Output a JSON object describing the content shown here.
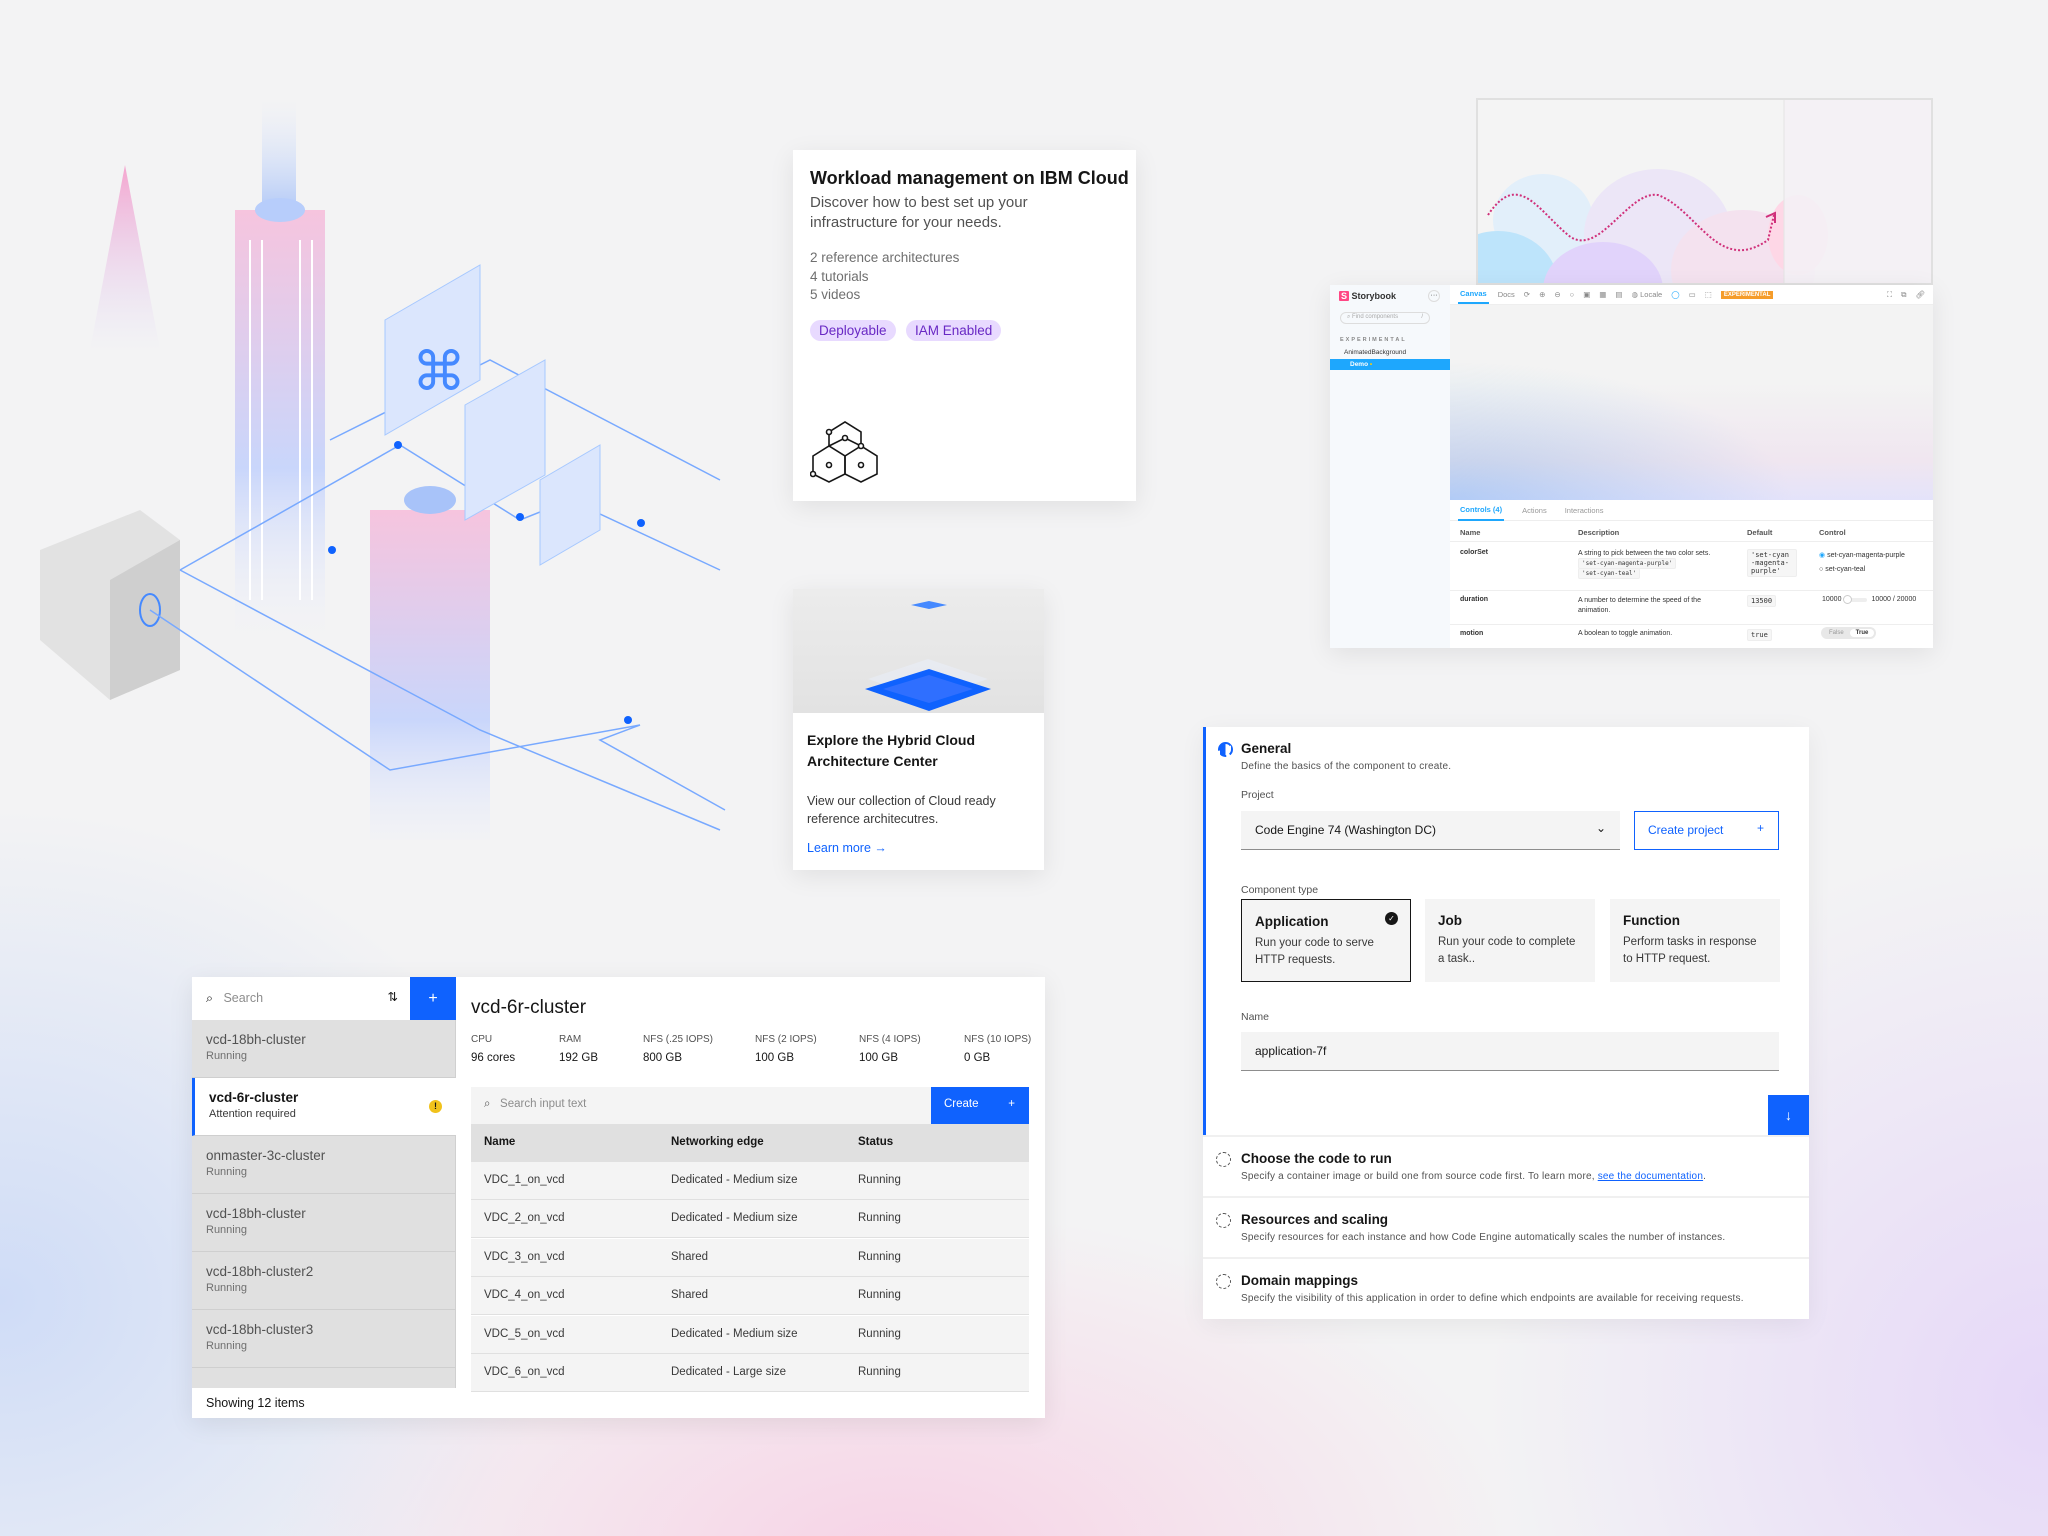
{
  "colors": {
    "accent": "#0f62fe",
    "tag_bg": "#e8daff",
    "tag_text": "#6929c4",
    "storybook_pink": "#ff4785",
    "experimental": "#f59c2a",
    "warning": "#f1c21b"
  },
  "workload_card": {
    "title": "Workload management on IBM Cloud",
    "description": "Discover how to best set up your infrastructure for your needs.",
    "meta": [
      "2 reference architectures",
      "4 tutorials",
      "5 videos"
    ],
    "tags": [
      "Deployable",
      "IAM Enabled"
    ],
    "icon": "hexagon-network-icon"
  },
  "hybrid_card": {
    "title": "Explore the Hybrid Cloud Architecture Center",
    "description": "View our collection of Cloud ready reference architecutres.",
    "link": "Learn more"
  },
  "storybook": {
    "brand": "Storybook",
    "search_placeholder": "Find components",
    "search_shortcut": "/",
    "group": "EXPERIMENTAL",
    "component": "AnimatedBackground",
    "story": "Demo",
    "toolbar": {
      "tabs": [
        "Canvas",
        "Docs"
      ],
      "locale": "Locale",
      "badge": "EXPERIMENTAL"
    },
    "addon_tabs": [
      "Controls (4)",
      "Actions",
      "Interactions"
    ],
    "columns": [
      "Name",
      "Description",
      "Default",
      "Control"
    ],
    "rows": [
      {
        "name": "colorSet",
        "description": "A string to pick between the two color sets.",
        "codes": [
          "'set-cyan-magenta-purple'",
          "'set-cyan-teal'"
        ],
        "default": "'set-cyan-magenta-purple'",
        "options": [
          "set-cyan-magenta-purple",
          "set-cyan-teal"
        ],
        "selected": 0
      },
      {
        "name": "duration",
        "description": "A number to determine the speed of the animation.",
        "default": "13500",
        "min": "10000",
        "range": "10000 / 20000",
        "value": 10000
      },
      {
        "name": "motion",
        "description": "A boolean to toggle animation.",
        "default": "true",
        "toggle": [
          "False",
          "True"
        ],
        "selected": "True"
      }
    ]
  },
  "form": {
    "general": {
      "title": "General",
      "description": "Define the basics of the component to create.",
      "status": "in-progress"
    },
    "project_label": "Project",
    "project_value": "Code Engine 74 (Washington DC)",
    "create_project": "Create project",
    "component_type_label": "Component type",
    "types": [
      {
        "title": "Application",
        "description": "Run your code to serve HTTP requests.",
        "selected": true
      },
      {
        "title": "Job",
        "description": "Run your code to complete a task..",
        "selected": false
      },
      {
        "title": "Function",
        "description": "Perform tasks in response to HTTP request.",
        "selected": false
      }
    ],
    "name_label": "Name",
    "name_value": "application-7f",
    "sections": [
      {
        "title": "Choose the code to run",
        "description": "Specify a container image or build one from source code first. To learn more, ",
        "link": "see the documentation",
        "suffix": "."
      },
      {
        "title": "Resources and scaling",
        "description": "Specify resources for each instance and how Code Engine automatically scales the number of instances."
      },
      {
        "title": "Domain mappings",
        "description": "Specify the visibility of this application in order to define which endpoints are available for receiving requests."
      }
    ]
  },
  "clusters": {
    "search_placeholder": "Search",
    "footer": "Showing 12 items",
    "items": [
      {
        "name": "vcd-18bh-cluster",
        "status": "Running"
      },
      {
        "name": "vcd-6r-cluster",
        "status": "Attention required",
        "selected": true
      },
      {
        "name": "onmaster-3c-cluster",
        "status": "Running"
      },
      {
        "name": "vcd-18bh-cluster",
        "status": "Running"
      },
      {
        "name": "vcd-18bh-cluster2",
        "status": "Running"
      },
      {
        "name": "vcd-18bh-cluster3",
        "status": "Running"
      }
    ],
    "detail": {
      "title": "vcd-6r-cluster",
      "stats": [
        {
          "label": "CPU",
          "value": "96 cores"
        },
        {
          "label": "RAM",
          "value": "192 GB"
        },
        {
          "label": "NFS (.25 IOPS)",
          "value": "800 GB"
        },
        {
          "label": "NFS (2 IOPS)",
          "value": "100 GB"
        },
        {
          "label": "NFS (4 IOPS)",
          "value": "100 GB"
        },
        {
          "label": "NFS (10 IOPS)",
          "value": "0 GB"
        }
      ],
      "search_placeholder": "Search input text",
      "create": "Create",
      "columns": [
        "Name",
        "Networking edge",
        "Status"
      ],
      "rows": [
        [
          "VDC_1_on_vcd",
          "Dedicated - Medium size",
          "Running"
        ],
        [
          "VDC_2_on_vcd",
          "Dedicated - Medium size",
          "Running"
        ],
        [
          "VDC_3_on_vcd",
          "Shared",
          "Running"
        ],
        [
          "VDC_4_on_vcd",
          "Shared",
          "Running"
        ],
        [
          "VDC_5_on_vcd",
          "Dedicated - Medium size",
          "Running"
        ],
        [
          "VDC_6_on_vcd",
          "Dedicated - Large size",
          "Running"
        ]
      ]
    }
  }
}
